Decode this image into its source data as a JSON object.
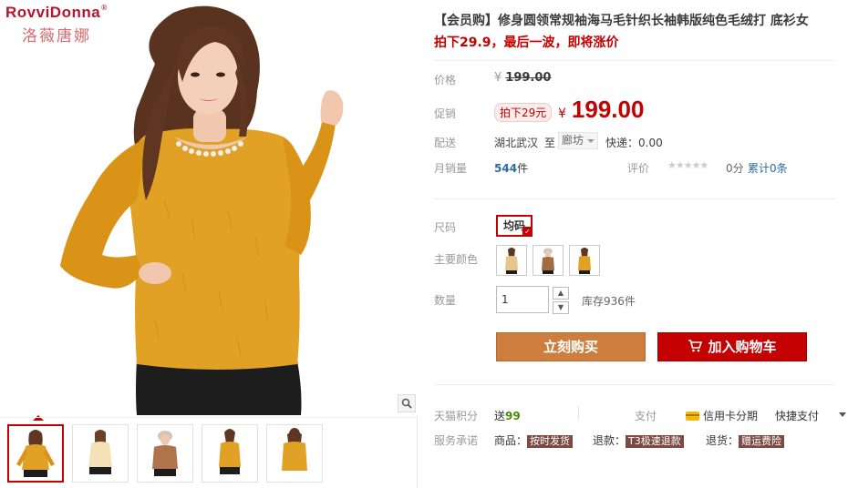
{
  "brand": {
    "name_en": "RovviDonna",
    "registered": "®",
    "name_cn": "洛薇唐娜"
  },
  "gallery": {
    "zoom_icon": "magnifier-icon",
    "thumbnails": [
      "thumb-yellow-front",
      "thumb-beige",
      "thumb-camel-with-hat",
      "thumb-yellow-side",
      "thumb-yellow-back"
    ]
  },
  "product": {
    "title": "【会员购】修身圆领常规袖海马毛针织长袖韩版纯色毛绒打 底衫女",
    "subtitle": "拍下29.9，最后一波，即将涨价"
  },
  "price": {
    "label": "价格",
    "currency": "¥",
    "original": "199.00"
  },
  "promo": {
    "label": "促销",
    "tag": "拍下29元",
    "currency": "¥",
    "price": "199.00"
  },
  "shipping": {
    "label": "配送",
    "from": "湖北武汉",
    "to_word": "至",
    "to_city": "廊坊",
    "fee": "快递：0.00"
  },
  "sales": {
    "label": "月销量",
    "count": "544",
    "unit": "件",
    "rating_label": "评价",
    "stars": "★★★★★",
    "score": "0分",
    "review_link": "累计0条"
  },
  "options": {
    "size_label": "尺码",
    "size_value": "均码",
    "color_label": "主要颜色",
    "colors": [
      "yellow",
      "beige",
      "camel"
    ],
    "qty_label": "数量",
    "qty_value": "1",
    "stock": "库存936件"
  },
  "actions": {
    "buy_now": "立刻购买",
    "add_cart": "加入购物车"
  },
  "extras": {
    "points_label": "天猫积分",
    "points_prefix": "送",
    "points_value": "99",
    "pay_label": "支付",
    "credit_pay": "信用卡分期",
    "quick_pay": "快捷支付",
    "service_label": "服务承诺",
    "service_items": [
      {
        "prefix": "商品：",
        "tag": "按时发货"
      },
      {
        "prefix": "退款：",
        "tag": "T3极速退款"
      },
      {
        "prefix": "退货：",
        "tag": "赠运费险"
      }
    ]
  },
  "colors": {
    "accent_red": "#c40000",
    "buy_orange": "#cd7e3f",
    "link_blue": "#2e6ca6",
    "sweater_yellow": "#e0a124"
  }
}
